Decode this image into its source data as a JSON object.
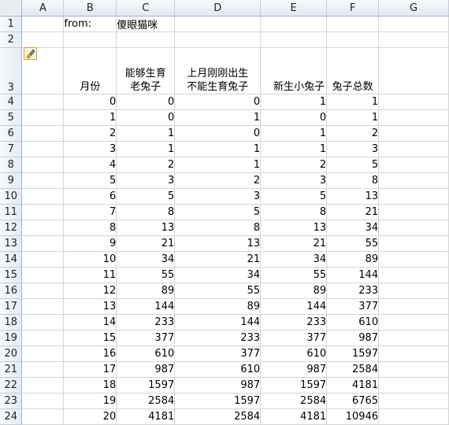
{
  "columns": [
    "A",
    "B",
    "C",
    "D",
    "E",
    "F",
    "G"
  ],
  "row1": {
    "from_label": "from:",
    "author": "傻眼猫咪"
  },
  "headers": {
    "month": "月份",
    "old": [
      "能够生育",
      "老兔子"
    ],
    "last": [
      "上月刚刚出生",
      "不能生育兔子"
    ],
    "new": "新生小兔子",
    "total": "兔子总数"
  },
  "rows": [
    {
      "r": "4",
      "cells": [
        "0",
        "0",
        "0",
        "1",
        "1"
      ]
    },
    {
      "r": "5",
      "cells": [
        "1",
        "0",
        "1",
        "0",
        "1"
      ]
    },
    {
      "r": "6",
      "cells": [
        "2",
        "1",
        "0",
        "1",
        "2"
      ]
    },
    {
      "r": "7",
      "cells": [
        "3",
        "1",
        "1",
        "1",
        "3"
      ]
    },
    {
      "r": "8",
      "cells": [
        "4",
        "2",
        "1",
        "2",
        "5"
      ]
    },
    {
      "r": "9",
      "cells": [
        "5",
        "3",
        "2",
        "3",
        "8"
      ]
    },
    {
      "r": "10",
      "cells": [
        "6",
        "5",
        "3",
        "5",
        "13"
      ]
    },
    {
      "r": "11",
      "cells": [
        "7",
        "8",
        "5",
        "8",
        "21"
      ]
    },
    {
      "r": "12",
      "cells": [
        "8",
        "13",
        "8",
        "13",
        "34"
      ]
    },
    {
      "r": "13",
      "cells": [
        "9",
        "21",
        "13",
        "21",
        "55"
      ]
    },
    {
      "r": "14",
      "cells": [
        "10",
        "34",
        "21",
        "34",
        "89"
      ]
    },
    {
      "r": "15",
      "cells": [
        "11",
        "55",
        "34",
        "55",
        "144"
      ]
    },
    {
      "r": "16",
      "cells": [
        "12",
        "89",
        "55",
        "89",
        "233"
      ]
    },
    {
      "r": "17",
      "cells": [
        "13",
        "144",
        "89",
        "144",
        "377"
      ]
    },
    {
      "r": "18",
      "cells": [
        "14",
        "233",
        "144",
        "233",
        "610"
      ]
    },
    {
      "r": "19",
      "cells": [
        "15",
        "377",
        "233",
        "377",
        "987"
      ]
    },
    {
      "r": "20",
      "cells": [
        "16",
        "610",
        "377",
        "610",
        "1597"
      ]
    },
    {
      "r": "21",
      "cells": [
        "17",
        "987",
        "610",
        "987",
        "2584"
      ]
    },
    {
      "r": "22",
      "cells": [
        "18",
        "1597",
        "987",
        "1597",
        "4181"
      ]
    },
    {
      "r": "23",
      "cells": [
        "19",
        "2584",
        "1597",
        "2584",
        "6765"
      ]
    },
    {
      "r": "24",
      "cells": [
        "20",
        "4181",
        "2584",
        "4181",
        "10946"
      ]
    }
  ],
  "row_labels_top": [
    "1",
    "2",
    "3"
  ],
  "icons": {
    "paste_options": "paintbrush-icon"
  },
  "colors": {
    "header_bg": "#e3e8ef",
    "grid_line": "#d4d4d4",
    "header_border": "#9eb6ce"
  }
}
